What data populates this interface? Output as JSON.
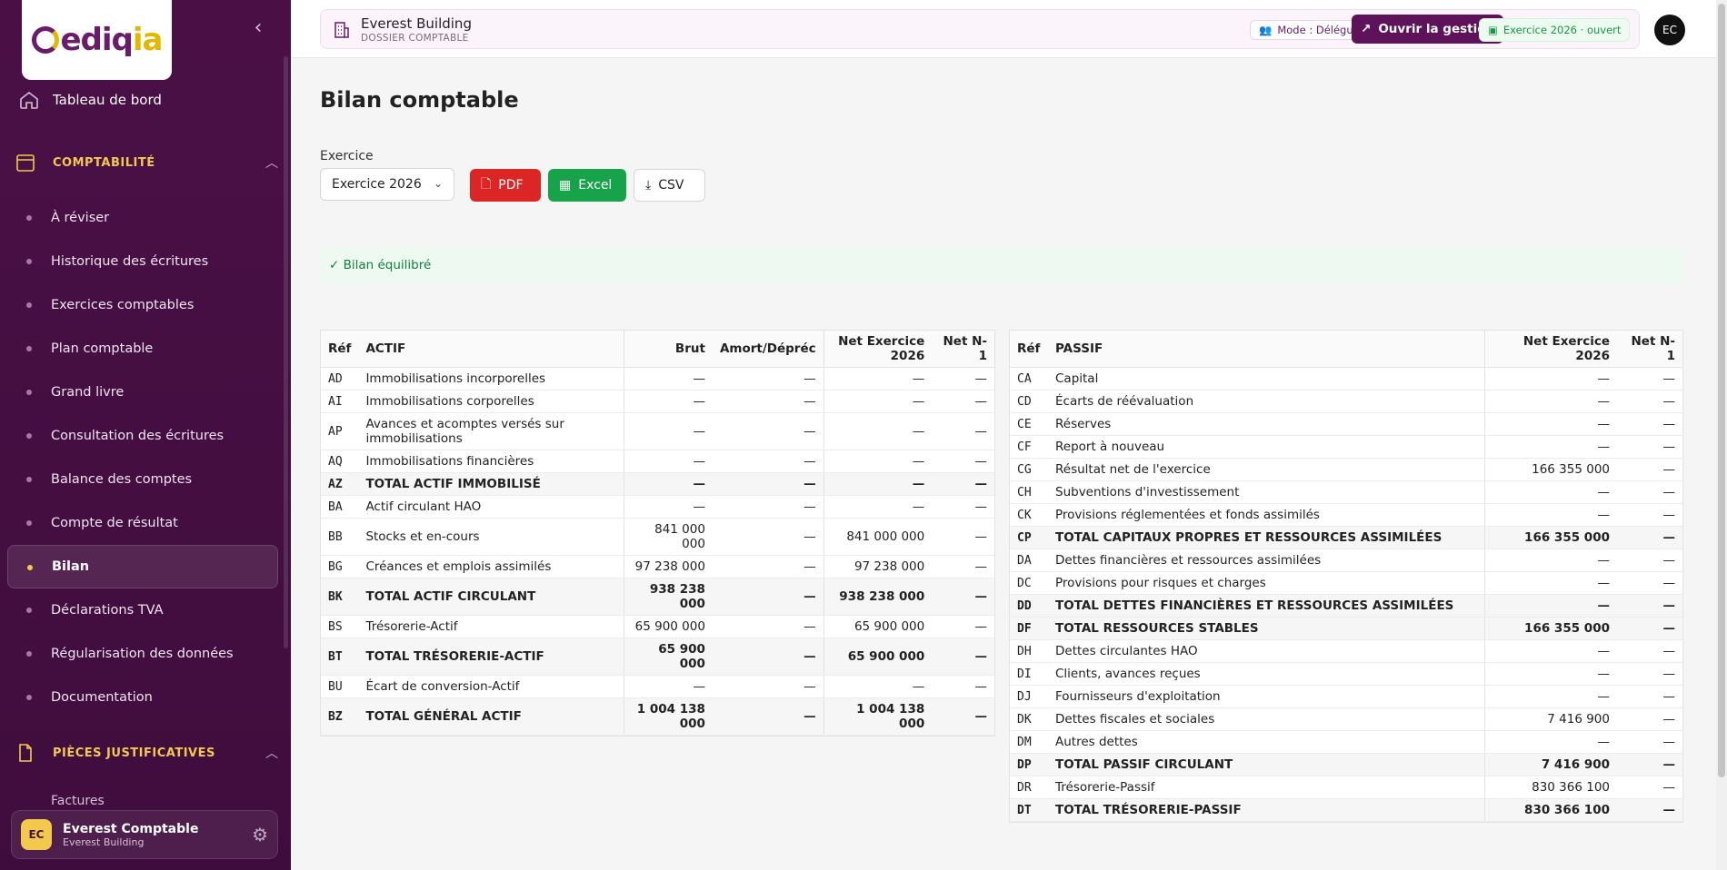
{
  "app": {
    "logo_main": "ediq",
    "logo_accent": "ia"
  },
  "sidebar": {
    "dashboard": "Tableau de bord",
    "section_compta": "COMPTABILITÉ",
    "items": [
      {
        "label": "À réviser",
        "active": false
      },
      {
        "label": "Historique des écritures",
        "active": false
      },
      {
        "label": "Exercices comptables",
        "active": false
      },
      {
        "label": "Plan comptable",
        "active": false
      },
      {
        "label": "Grand livre",
        "active": false
      },
      {
        "label": "Consultation des écritures",
        "active": false
      },
      {
        "label": "Balance des comptes",
        "active": false
      },
      {
        "label": "Compte de résultat",
        "active": false
      },
      {
        "label": "Bilan",
        "active": true
      },
      {
        "label": "Déclarations TVA",
        "active": false
      },
      {
        "label": "Régularisation des données",
        "active": false
      },
      {
        "label": "Documentation",
        "active": false
      }
    ],
    "section_pieces": "PIÈCES JUSTIFICATIVES",
    "partial_item": "Factures",
    "user": {
      "initials": "EC",
      "name": "Everest Comptable",
      "org": "Everest Building"
    }
  },
  "topbar": {
    "company": "Everest Building",
    "subtitle": "DOSSIER COMPTABLE",
    "mode": "Mode : Déléguée",
    "open_button": "Ouvrir la gestion",
    "exercise_status": "Exercice 2026 · ouvert",
    "avatar": "EC"
  },
  "page": {
    "title": "Bilan comptable",
    "exercise_label": "Exercice",
    "exercise_value": "Exercice 2026",
    "pdf": "PDF",
    "excel": "Excel",
    "csv": "CSV",
    "status": "✓ Bilan équilibré"
  },
  "actif": {
    "headers": [
      "Réf",
      "ACTIF",
      "Brut",
      "Amort/Dépréc",
      "Net Exercice 2026",
      "Net N-1"
    ],
    "rows": [
      {
        "ref": "AD",
        "label": "Immobilisations incorporelles",
        "brut": "—",
        "amort": "—",
        "net": "—",
        "n1": "—",
        "total": false
      },
      {
        "ref": "AI",
        "label": "Immobilisations corporelles",
        "brut": "—",
        "amort": "—",
        "net": "—",
        "n1": "—",
        "total": false
      },
      {
        "ref": "AP",
        "label": "Avances et acomptes versés sur immobilisations",
        "brut": "—",
        "amort": "—",
        "net": "—",
        "n1": "—",
        "total": false
      },
      {
        "ref": "AQ",
        "label": "Immobilisations financières",
        "brut": "—",
        "amort": "—",
        "net": "—",
        "n1": "—",
        "total": false
      },
      {
        "ref": "AZ",
        "label": "TOTAL ACTIF IMMOBILISÉ",
        "brut": "—",
        "amort": "—",
        "net": "—",
        "n1": "—",
        "total": true
      },
      {
        "ref": "BA",
        "label": "Actif circulant HAO",
        "brut": "—",
        "amort": "—",
        "net": "—",
        "n1": "—",
        "total": false
      },
      {
        "ref": "BB",
        "label": "Stocks et en-cours",
        "brut": "841 000 000",
        "amort": "—",
        "net": "841 000 000",
        "n1": "—",
        "total": false
      },
      {
        "ref": "BG",
        "label": "Créances et emplois assimilés",
        "brut": "97 238 000",
        "amort": "—",
        "net": "97 238 000",
        "n1": "—",
        "total": false
      },
      {
        "ref": "BK",
        "label": "TOTAL ACTIF CIRCULANT",
        "brut": "938 238 000",
        "amort": "—",
        "net": "938 238 000",
        "n1": "—",
        "total": true
      },
      {
        "ref": "BS",
        "label": "Trésorerie-Actif",
        "brut": "65 900 000",
        "amort": "—",
        "net": "65 900 000",
        "n1": "—",
        "total": false
      },
      {
        "ref": "BT",
        "label": "TOTAL TRÉSORERIE-ACTIF",
        "brut": "65 900 000",
        "amort": "—",
        "net": "65 900 000",
        "n1": "—",
        "total": true
      },
      {
        "ref": "BU",
        "label": "Écart de conversion-Actif",
        "brut": "—",
        "amort": "—",
        "net": "—",
        "n1": "—",
        "total": false
      },
      {
        "ref": "BZ",
        "label": "TOTAL GÉNÉRAL ACTIF",
        "brut": "1 004 138 000",
        "amort": "—",
        "net": "1 004 138 000",
        "n1": "—",
        "total": true
      }
    ]
  },
  "passif": {
    "headers": [
      "Réf",
      "PASSIF",
      "Net Exercice 2026",
      "Net N-1"
    ],
    "rows": [
      {
        "ref": "CA",
        "label": "Capital",
        "net": "—",
        "n1": "—",
        "total": false
      },
      {
        "ref": "CD",
        "label": "Écarts de réévaluation",
        "net": "—",
        "n1": "—",
        "total": false
      },
      {
        "ref": "CE",
        "label": "Réserves",
        "net": "—",
        "n1": "—",
        "total": false
      },
      {
        "ref": "CF",
        "label": "Report à nouveau",
        "net": "—",
        "n1": "—",
        "total": false
      },
      {
        "ref": "CG",
        "label": "Résultat net de l'exercice",
        "net": "166 355 000",
        "n1": "—",
        "total": false
      },
      {
        "ref": "CH",
        "label": "Subventions d'investissement",
        "net": "—",
        "n1": "—",
        "total": false
      },
      {
        "ref": "CK",
        "label": "Provisions réglementées et fonds assimilés",
        "net": "—",
        "n1": "—",
        "total": false
      },
      {
        "ref": "CP",
        "label": "TOTAL CAPITAUX PROPRES ET RESSOURCES ASSIMILÉES",
        "net": "166 355 000",
        "n1": "—",
        "total": true
      },
      {
        "ref": "DA",
        "label": "Dettes financières et ressources assimilées",
        "net": "—",
        "n1": "—",
        "total": false
      },
      {
        "ref": "DC",
        "label": "Provisions pour risques et charges",
        "net": "—",
        "n1": "—",
        "total": false
      },
      {
        "ref": "DD",
        "label": "TOTAL DETTES FINANCIÈRES ET RESSOURCES ASSIMILÉES",
        "net": "—",
        "n1": "—",
        "total": true
      },
      {
        "ref": "DF",
        "label": "TOTAL RESSOURCES STABLES",
        "net": "166 355 000",
        "n1": "—",
        "total": true
      },
      {
        "ref": "DH",
        "label": "Dettes circulantes HAO",
        "net": "—",
        "n1": "—",
        "total": false
      },
      {
        "ref": "DI",
        "label": "Clients, avances reçues",
        "net": "—",
        "n1": "—",
        "total": false
      },
      {
        "ref": "DJ",
        "label": "Fournisseurs d'exploitation",
        "net": "—",
        "n1": "—",
        "total": false
      },
      {
        "ref": "DK",
        "label": "Dettes fiscales et sociales",
        "net": "7 416 900",
        "n1": "—",
        "total": false
      },
      {
        "ref": "DM",
        "label": "Autres dettes",
        "net": "—",
        "n1": "—",
        "total": false
      },
      {
        "ref": "DP",
        "label": "TOTAL PASSIF CIRCULANT",
        "net": "7 416 900",
        "n1": "—",
        "total": true
      },
      {
        "ref": "DR",
        "label": "Trésorerie-Passif",
        "net": "830 366 100",
        "n1": "—",
        "total": false
      },
      {
        "ref": "DT",
        "label": "TOTAL TRÉSORERIE-PASSIF",
        "net": "830 366 100",
        "n1": "—",
        "total": true
      }
    ]
  }
}
